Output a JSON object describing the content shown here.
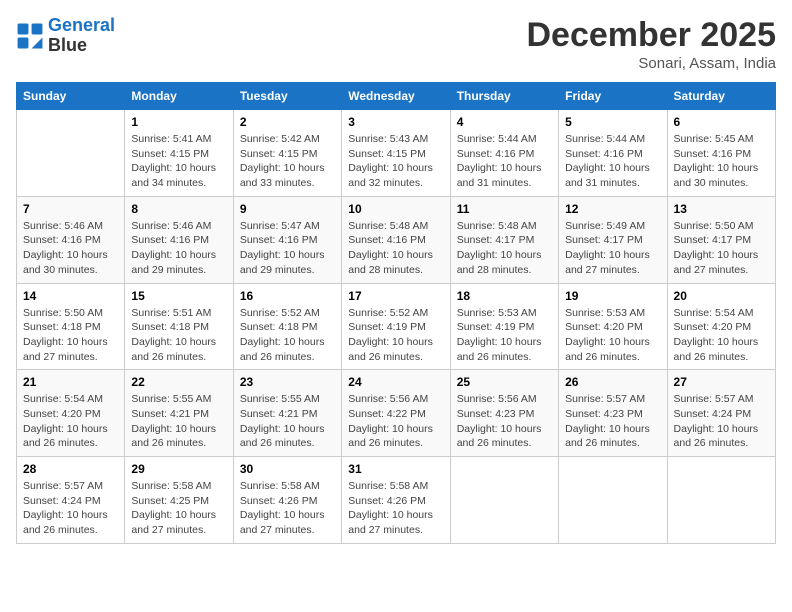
{
  "header": {
    "logo_line1": "General",
    "logo_line2": "Blue",
    "month": "December 2025",
    "location": "Sonari, Assam, India"
  },
  "weekdays": [
    "Sunday",
    "Monday",
    "Tuesday",
    "Wednesday",
    "Thursday",
    "Friday",
    "Saturday"
  ],
  "weeks": [
    [
      {
        "day": "",
        "info": ""
      },
      {
        "day": "1",
        "info": "Sunrise: 5:41 AM\nSunset: 4:15 PM\nDaylight: 10 hours\nand 34 minutes."
      },
      {
        "day": "2",
        "info": "Sunrise: 5:42 AM\nSunset: 4:15 PM\nDaylight: 10 hours\nand 33 minutes."
      },
      {
        "day": "3",
        "info": "Sunrise: 5:43 AM\nSunset: 4:15 PM\nDaylight: 10 hours\nand 32 minutes."
      },
      {
        "day": "4",
        "info": "Sunrise: 5:44 AM\nSunset: 4:16 PM\nDaylight: 10 hours\nand 31 minutes."
      },
      {
        "day": "5",
        "info": "Sunrise: 5:44 AM\nSunset: 4:16 PM\nDaylight: 10 hours\nand 31 minutes."
      },
      {
        "day": "6",
        "info": "Sunrise: 5:45 AM\nSunset: 4:16 PM\nDaylight: 10 hours\nand 30 minutes."
      }
    ],
    [
      {
        "day": "7",
        "info": "Sunrise: 5:46 AM\nSunset: 4:16 PM\nDaylight: 10 hours\nand 30 minutes."
      },
      {
        "day": "8",
        "info": "Sunrise: 5:46 AM\nSunset: 4:16 PM\nDaylight: 10 hours\nand 29 minutes."
      },
      {
        "day": "9",
        "info": "Sunrise: 5:47 AM\nSunset: 4:16 PM\nDaylight: 10 hours\nand 29 minutes."
      },
      {
        "day": "10",
        "info": "Sunrise: 5:48 AM\nSunset: 4:16 PM\nDaylight: 10 hours\nand 28 minutes."
      },
      {
        "day": "11",
        "info": "Sunrise: 5:48 AM\nSunset: 4:17 PM\nDaylight: 10 hours\nand 28 minutes."
      },
      {
        "day": "12",
        "info": "Sunrise: 5:49 AM\nSunset: 4:17 PM\nDaylight: 10 hours\nand 27 minutes."
      },
      {
        "day": "13",
        "info": "Sunrise: 5:50 AM\nSunset: 4:17 PM\nDaylight: 10 hours\nand 27 minutes."
      }
    ],
    [
      {
        "day": "14",
        "info": "Sunrise: 5:50 AM\nSunset: 4:18 PM\nDaylight: 10 hours\nand 27 minutes."
      },
      {
        "day": "15",
        "info": "Sunrise: 5:51 AM\nSunset: 4:18 PM\nDaylight: 10 hours\nand 26 minutes."
      },
      {
        "day": "16",
        "info": "Sunrise: 5:52 AM\nSunset: 4:18 PM\nDaylight: 10 hours\nand 26 minutes."
      },
      {
        "day": "17",
        "info": "Sunrise: 5:52 AM\nSunset: 4:19 PM\nDaylight: 10 hours\nand 26 minutes."
      },
      {
        "day": "18",
        "info": "Sunrise: 5:53 AM\nSunset: 4:19 PM\nDaylight: 10 hours\nand 26 minutes."
      },
      {
        "day": "19",
        "info": "Sunrise: 5:53 AM\nSunset: 4:20 PM\nDaylight: 10 hours\nand 26 minutes."
      },
      {
        "day": "20",
        "info": "Sunrise: 5:54 AM\nSunset: 4:20 PM\nDaylight: 10 hours\nand 26 minutes."
      }
    ],
    [
      {
        "day": "21",
        "info": "Sunrise: 5:54 AM\nSunset: 4:20 PM\nDaylight: 10 hours\nand 26 minutes."
      },
      {
        "day": "22",
        "info": "Sunrise: 5:55 AM\nSunset: 4:21 PM\nDaylight: 10 hours\nand 26 minutes."
      },
      {
        "day": "23",
        "info": "Sunrise: 5:55 AM\nSunset: 4:21 PM\nDaylight: 10 hours\nand 26 minutes."
      },
      {
        "day": "24",
        "info": "Sunrise: 5:56 AM\nSunset: 4:22 PM\nDaylight: 10 hours\nand 26 minutes."
      },
      {
        "day": "25",
        "info": "Sunrise: 5:56 AM\nSunset: 4:23 PM\nDaylight: 10 hours\nand 26 minutes."
      },
      {
        "day": "26",
        "info": "Sunrise: 5:57 AM\nSunset: 4:23 PM\nDaylight: 10 hours\nand 26 minutes."
      },
      {
        "day": "27",
        "info": "Sunrise: 5:57 AM\nSunset: 4:24 PM\nDaylight: 10 hours\nand 26 minutes."
      }
    ],
    [
      {
        "day": "28",
        "info": "Sunrise: 5:57 AM\nSunset: 4:24 PM\nDaylight: 10 hours\nand 26 minutes."
      },
      {
        "day": "29",
        "info": "Sunrise: 5:58 AM\nSunset: 4:25 PM\nDaylight: 10 hours\nand 27 minutes."
      },
      {
        "day": "30",
        "info": "Sunrise: 5:58 AM\nSunset: 4:26 PM\nDaylight: 10 hours\nand 27 minutes."
      },
      {
        "day": "31",
        "info": "Sunrise: 5:58 AM\nSunset: 4:26 PM\nDaylight: 10 hours\nand 27 minutes."
      },
      {
        "day": "",
        "info": ""
      },
      {
        "day": "",
        "info": ""
      },
      {
        "day": "",
        "info": ""
      }
    ]
  ]
}
